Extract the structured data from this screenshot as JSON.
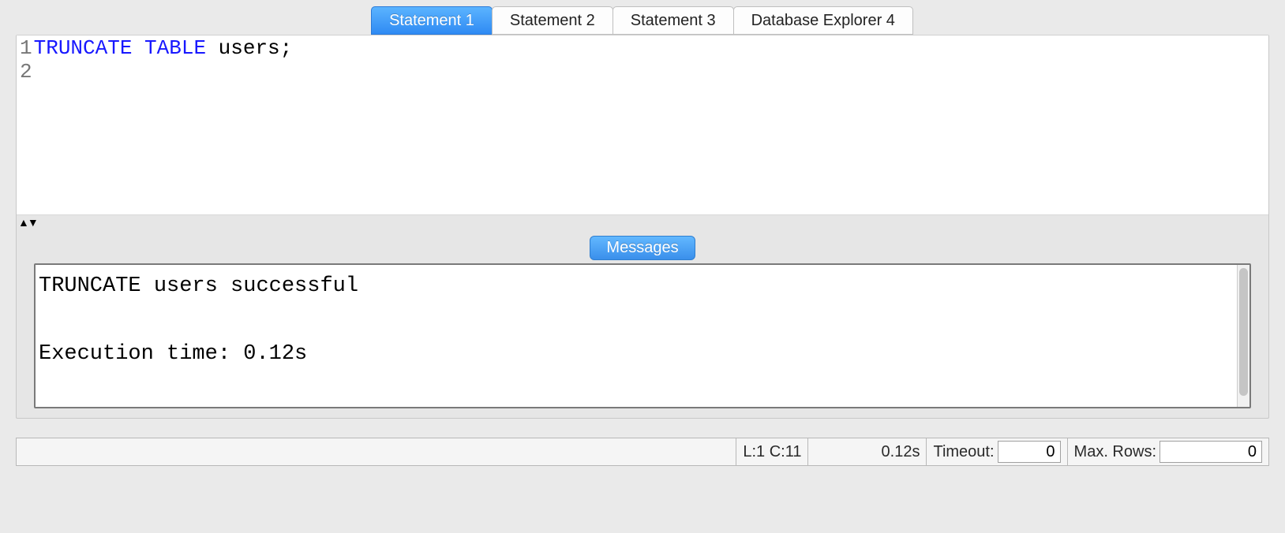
{
  "tabs": [
    {
      "label": "Statement 1",
      "active": true
    },
    {
      "label": "Statement 2",
      "active": false
    },
    {
      "label": "Statement 3",
      "active": false
    },
    {
      "label": "Database Explorer 4",
      "active": false
    }
  ],
  "editor": {
    "line_numbers": [
      "1",
      "2"
    ],
    "code": {
      "keyword": "TRUNCATE TABLE",
      "rest": " users;"
    }
  },
  "splitter_glyph": "▲▼",
  "messages": {
    "tab_label": "Messages",
    "text": "TRUNCATE users successful\n\nExecution time: 0.12s"
  },
  "status": {
    "cursor": "L:1 C:11",
    "exec_time": "0.12s",
    "timeout_label": "Timeout:",
    "timeout_value": "0",
    "maxrows_label": "Max. Rows:",
    "maxrows_value": "0"
  }
}
